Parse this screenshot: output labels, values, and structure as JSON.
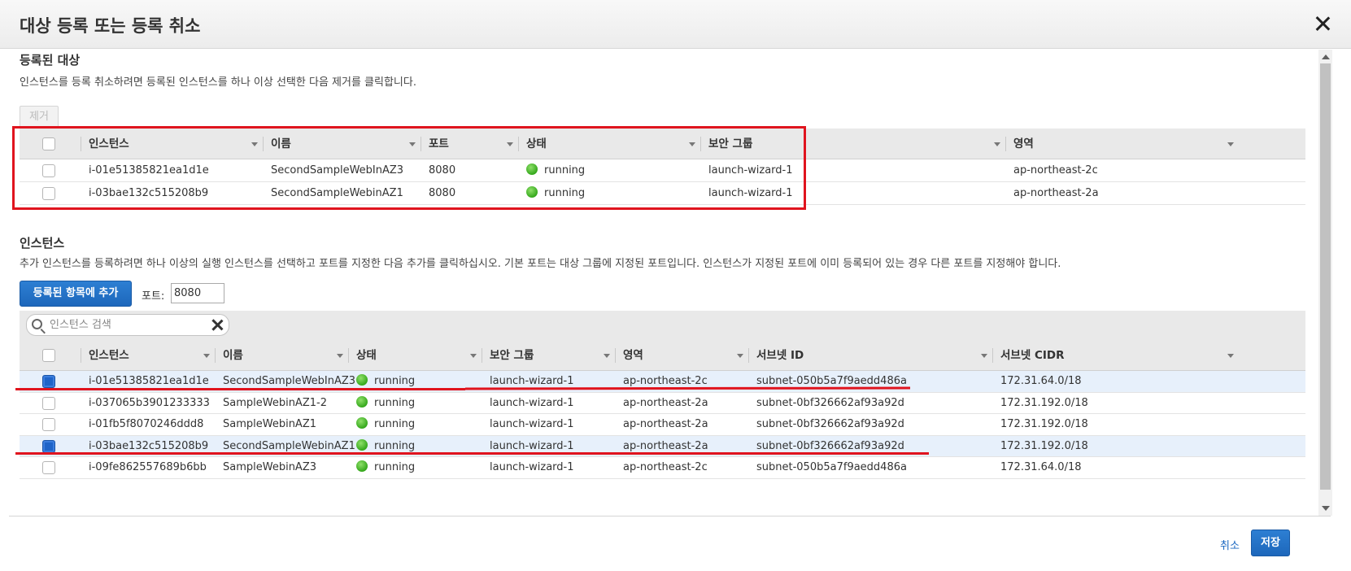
{
  "dialog": {
    "title": "대상 등록 또는 등록 취소"
  },
  "registered": {
    "title": "등록된 대상",
    "description": "인스턴스를 등록 취소하려면 등록된 인스턴스를 하나 이상 선택한 다음 제거를 클릭합니다.",
    "remove_label": "제거",
    "columns": [
      "인스턴스",
      "이름",
      "포트",
      "상태",
      "보안 그룹",
      "영역"
    ],
    "rows": [
      {
        "instance": "i-01e51385821ea1d1e",
        "name": "SecondSampleWebInAZ3",
        "port": "8080",
        "status": "running",
        "security_group": "launch-wizard-1",
        "zone": "ap-northeast-2c"
      },
      {
        "instance": "i-03bae132c515208b9",
        "name": "SecondSampleWebinAZ1",
        "port": "8080",
        "status": "running",
        "security_group": "launch-wizard-1",
        "zone": "ap-northeast-2a"
      }
    ]
  },
  "instances": {
    "title": "인스턴스",
    "description": "추가 인스턴스를 등록하려면 하나 이상의 실행 인스턴스를 선택하고 포트를 지정한 다음 추가를 클릭하십시오. 기본 포트는 대상 그룹에 지정된 포트입니다. 인스턴스가 지정된 포트에 이미 등록되어 있는 경우 다른 포트를 지정해야 합니다.",
    "add_label": "등록된 항목에 추가",
    "port_label": "포트:",
    "port_value": "8080",
    "search_placeholder": "인스턴스 검색",
    "columns": [
      "인스턴스",
      "이름",
      "상태",
      "보안 그룹",
      "영역",
      "서브넷 ID",
      "서브넷 CIDR"
    ],
    "rows": [
      {
        "selected": true,
        "instance": "i-01e51385821ea1d1e",
        "name": "SecondSampleWebInAZ3",
        "status": "running",
        "security_group": "launch-wizard-1",
        "zone": "ap-northeast-2c",
        "subnet": "subnet-050b5a7f9aedd486a",
        "cidr": "172.31.64.0/18"
      },
      {
        "selected": false,
        "instance": "i-037065b3901233333",
        "name": "SampleWebinAZ1-2",
        "status": "running",
        "security_group": "launch-wizard-1",
        "zone": "ap-northeast-2a",
        "subnet": "subnet-0bf326662af93a92d",
        "cidr": "172.31.192.0/18"
      },
      {
        "selected": false,
        "instance": "i-01fb5f8070246ddd8",
        "name": "SampleWebinAZ1",
        "status": "running",
        "security_group": "launch-wizard-1",
        "zone": "ap-northeast-2a",
        "subnet": "subnet-0bf326662af93a92d",
        "cidr": "172.31.192.0/18"
      },
      {
        "selected": true,
        "instance": "i-03bae132c515208b9",
        "name": "SecondSampleWebinAZ1",
        "status": "running",
        "security_group": "launch-wizard-1",
        "zone": "ap-northeast-2a",
        "subnet": "subnet-0bf326662af93a92d",
        "cidr": "172.31.192.0/18"
      },
      {
        "selected": false,
        "instance": "i-09fe862557689b6bb",
        "name": "SampleWebinAZ3",
        "status": "running",
        "security_group": "launch-wizard-1",
        "zone": "ap-northeast-2c",
        "subnet": "subnet-050b5a7f9aedd486a",
        "cidr": "172.31.64.0/18"
      }
    ]
  },
  "footer": {
    "cancel_label": "취소",
    "save_label": "저장"
  },
  "colors": {
    "primary": "#1d67bb",
    "selected_row": "#e7f0fb",
    "annotation_red": "#e0141e",
    "status_green": "#35a81c"
  },
  "icons": [
    "close-icon",
    "search-icon",
    "clear-icon",
    "sort-caret-icon",
    "status-dot-icon"
  ]
}
